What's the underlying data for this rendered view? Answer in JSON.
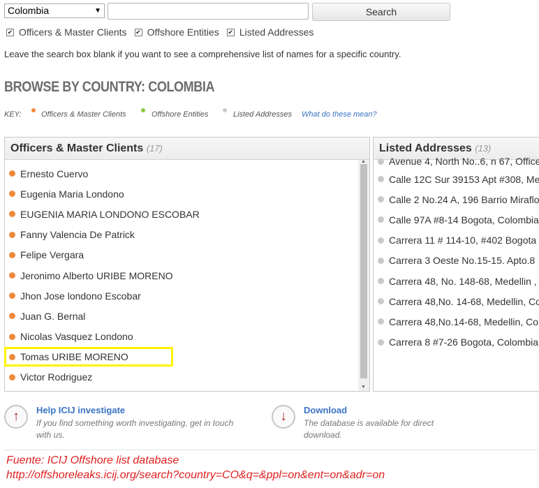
{
  "search": {
    "country_value": "Colombia",
    "query_value": "",
    "query_placeholder": "",
    "button_label": "Search"
  },
  "filters": [
    {
      "label": "Officers & Master Clients",
      "checked": true
    },
    {
      "label": "Offshore Entities",
      "checked": true
    },
    {
      "label": "Listed Addresses",
      "checked": true
    }
  ],
  "hint": "Leave the search box blank if you want to see a comprehensive list of names for a specific country.",
  "browse_title": "BROWSE BY COUNTRY: COLOMBIA",
  "key": {
    "label": "KEY:",
    "items": [
      {
        "label": "Officers & Master Clients",
        "color": "#ef8a3c"
      },
      {
        "label": "Offshore Entities",
        "color": "#8cc63e"
      },
      {
        "label": "Listed Addresses",
        "color": "#c9c9c9"
      }
    ],
    "link": "What do these mean?"
  },
  "officers": {
    "title": "Officers & Master Clients",
    "count": "(17)",
    "items": [
      "Ernesto Cuervo",
      "Eugenia Maria Londono",
      "EUGENIA MARIA LONDONO ESCOBAR",
      "Fanny Valencia De Patrick",
      "Felipe Vergara",
      "Jeronimo Alberto URIBE MORENO",
      "Jhon Jose londono Escobar",
      "Juan G. Bernal",
      "Nicolas Vasquez Londono",
      "Tomas URIBE MORENO",
      "Victor Rodriguez"
    ],
    "highlighted_item": "Tomas URIBE MORENO"
  },
  "addresses": {
    "title": "Listed Addresses",
    "count": "(13)",
    "items": [
      "Avenue 4, North No..6, n 67, Office",
      "Calle 12C Sur 39153 Apt #308, Me",
      "Calle 2 No.24 A, 196 Barrio Miraflo",
      "Calle 97A #8-14 Bogota, Colombia",
      "Carrera 11 # 114-10, #402 Bogota",
      "Carrera 3 Oeste No.15-15. Apto.8",
      "Carrera 48, No. 148-68, Medellin ,",
      "Carrera 48,No. 14-68, Medellin, Co",
      "Carrera 48,No.14-68, Medellin, Co",
      "Carrera 8 #7-26 Bogota, Colombia"
    ]
  },
  "actions": {
    "help": {
      "title": "Help ICIJ investigate",
      "desc_line1": "If you find something worth investigating, get in touch",
      "desc_line2": "with us."
    },
    "download": {
      "title": "Download",
      "desc_line1": "The database is available for direct",
      "desc_line2": "download."
    }
  },
  "source": {
    "line1": "Fuente: ICIJ Offshore list database",
    "line2": "http://offshoreleaks.icij.org/search?country=CO&q=&ppl=on&ent=on&adr=on"
  },
  "colors": {
    "officer_dot": "#ef8a3c",
    "entity_dot": "#8cc63e",
    "address_dot": "#c9c9c9",
    "link": "#3a73c4",
    "highlight": "#fff200",
    "source_text": "#e02020"
  }
}
